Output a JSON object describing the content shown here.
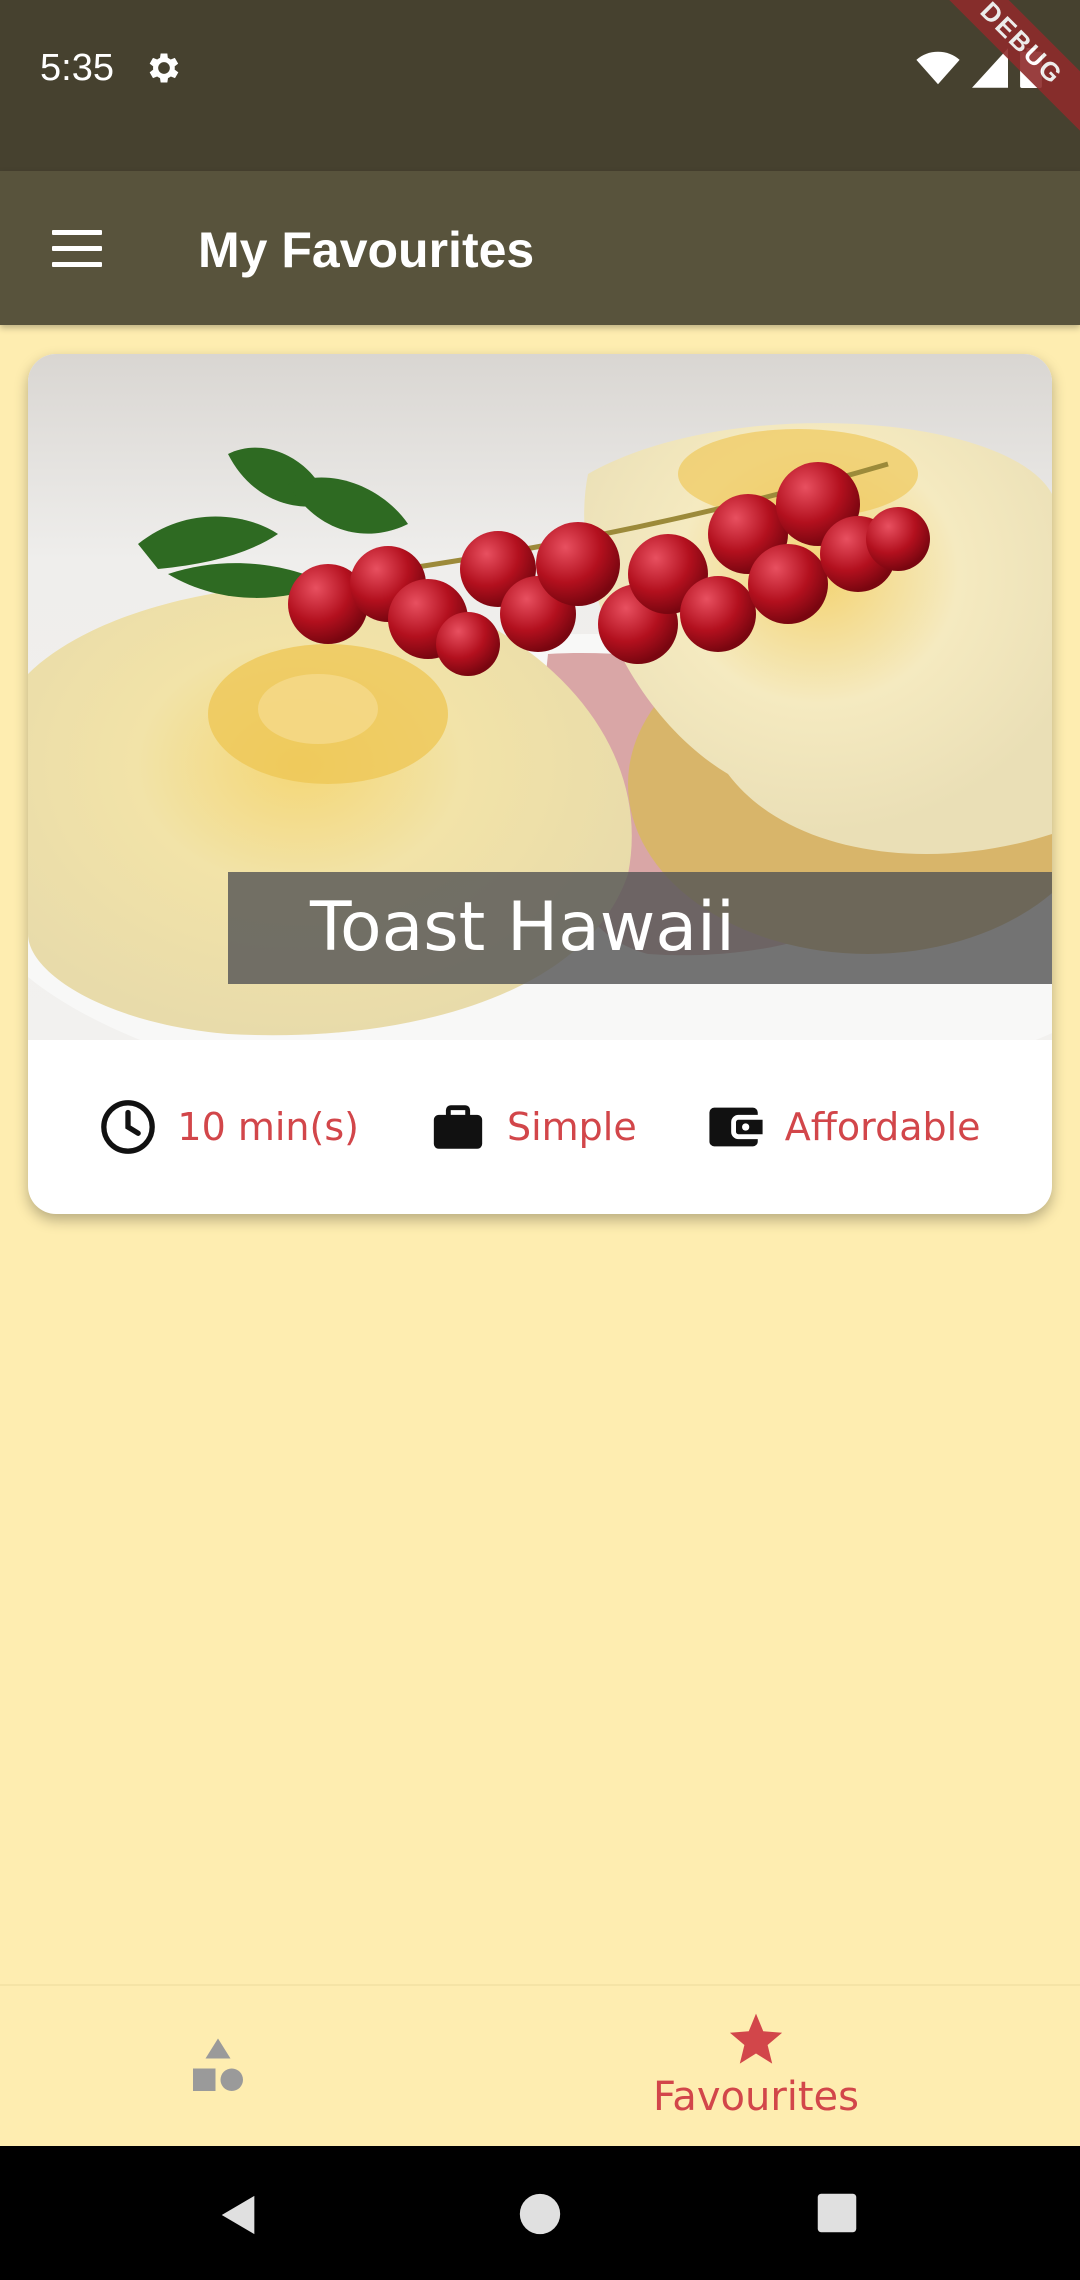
{
  "status_bar": {
    "time": "5:35",
    "debug_banner": "DEBUG",
    "icons": [
      "gear-icon",
      "wifi-icon",
      "signal-icon",
      "battery-icon"
    ]
  },
  "app_bar": {
    "title": "My Favourites",
    "menu_icon": "menu-icon"
  },
  "meal_card": {
    "title": "Toast Hawaii",
    "image": "toast-hawaii-photo",
    "duration": "10 min(s)",
    "complexity": "Simple",
    "affordability": "Affordable"
  },
  "bottom_nav": {
    "items": [
      {
        "icon": "category-shapes-icon",
        "label": "",
        "selected": false
      },
      {
        "icon": "star-icon",
        "label": "Favourites",
        "selected": true
      }
    ]
  },
  "colors": {
    "background": "#FEEDB0",
    "status_bar": "#46412F",
    "app_bar": "#58533C",
    "accent": "#D2464A",
    "inactive_icon": "#9A9A9A"
  },
  "system_nav": {
    "buttons": [
      "back-icon",
      "home-icon",
      "recents-icon"
    ]
  }
}
